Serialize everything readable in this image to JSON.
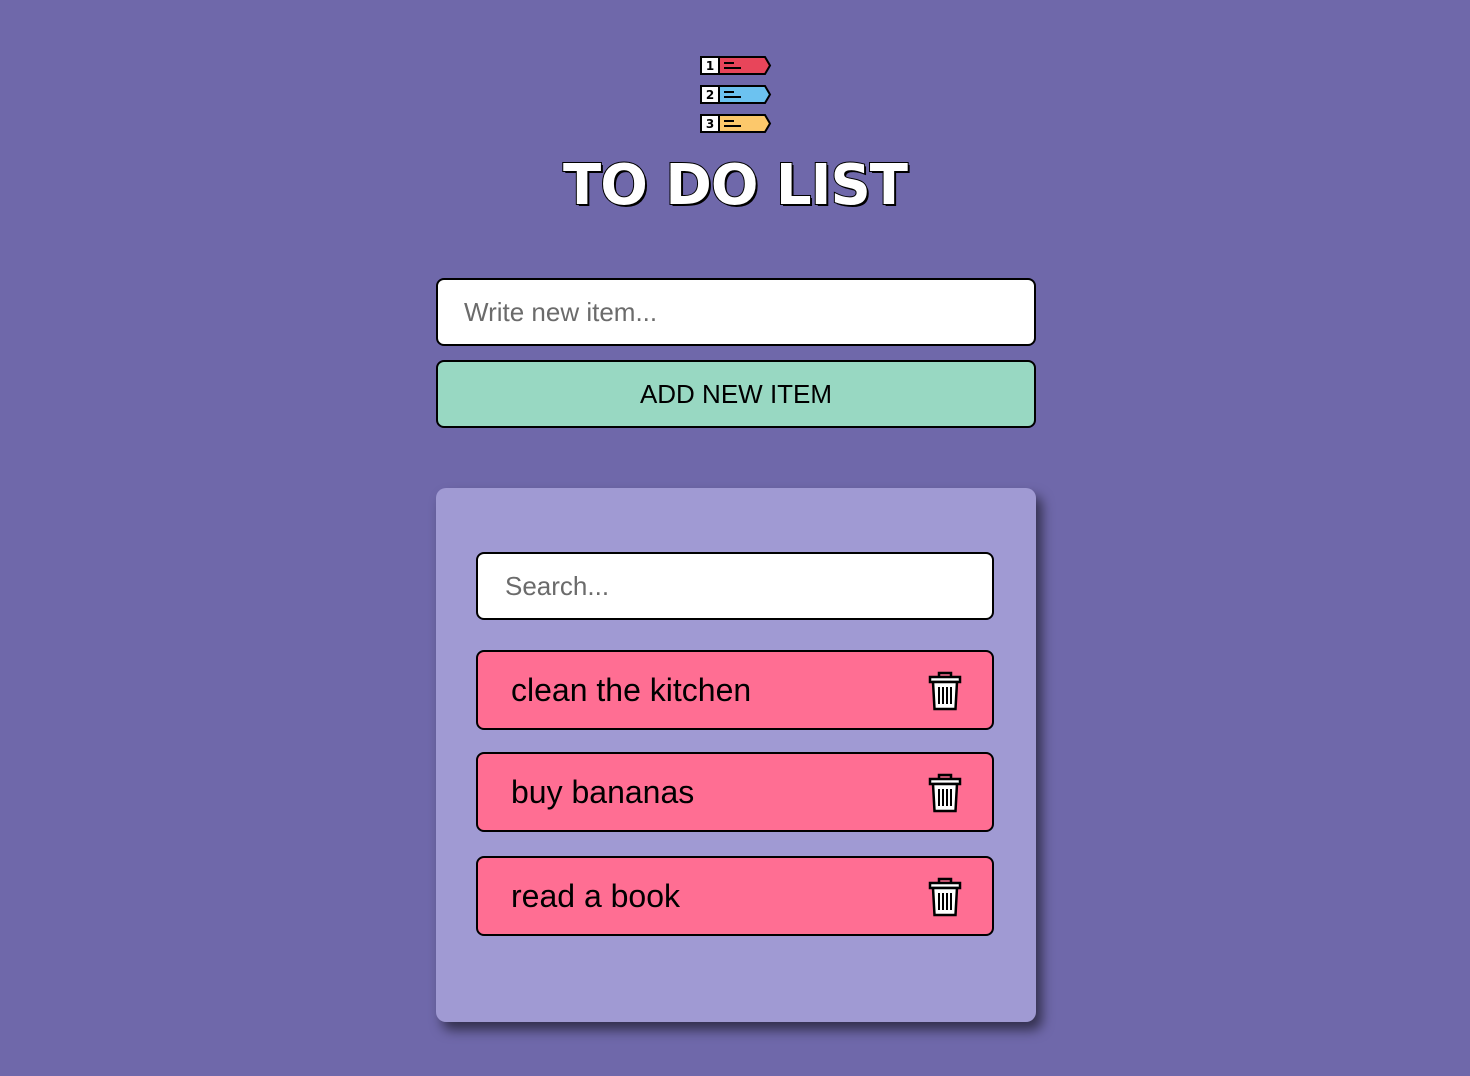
{
  "header": {
    "logo_icon": "numbered-list-icon",
    "title": "TO DO LIST"
  },
  "new_item": {
    "placeholder": "Write new item...",
    "value": "",
    "add_button_label": "ADD NEW ITEM"
  },
  "list_panel": {
    "search_placeholder": "Search...",
    "search_value": "",
    "delete_icon": "trash-icon",
    "items": [
      {
        "text": "clean the kitchen"
      },
      {
        "text": "buy bananas"
      },
      {
        "text": "read a book"
      }
    ]
  },
  "colors": {
    "background": "#6f68aa",
    "panel": "#a09ad3",
    "add_button": "#98d8c2",
    "item": "#ff6e93"
  }
}
